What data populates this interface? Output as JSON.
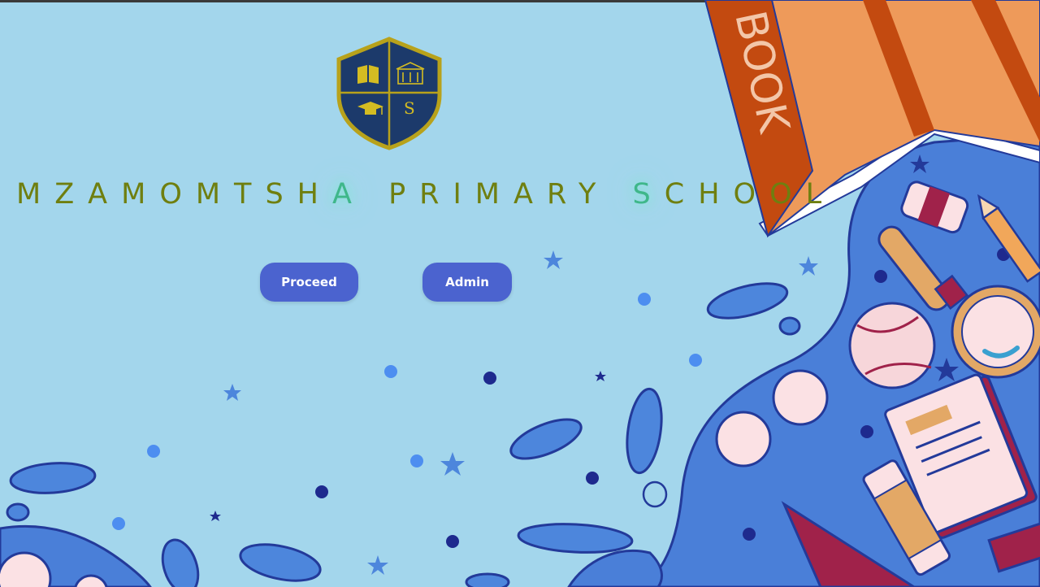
{
  "school": {
    "name_parts": [
      {
        "text": "MZAMOMTSH",
        "highlight": false
      },
      {
        "text": "A",
        "highlight": true
      },
      {
        "text": " PRIMARY ",
        "highlight": false
      },
      {
        "text": "S",
        "highlight": true
      },
      {
        "text": "CHOOL",
        "highlight": false
      }
    ],
    "crest_letter": "S"
  },
  "actions": {
    "proceed_label": "Proceed",
    "admin_label": "Admin"
  },
  "illustration": {
    "book_spine_text": "BOOK"
  },
  "colors": {
    "background": "#a3d6ec",
    "button": "#4b63cf",
    "title": "#6f7f10",
    "title_glow": "#3fb78a",
    "crest_navy": "#1c3a6b",
    "crest_gold": "#b8a21b"
  }
}
